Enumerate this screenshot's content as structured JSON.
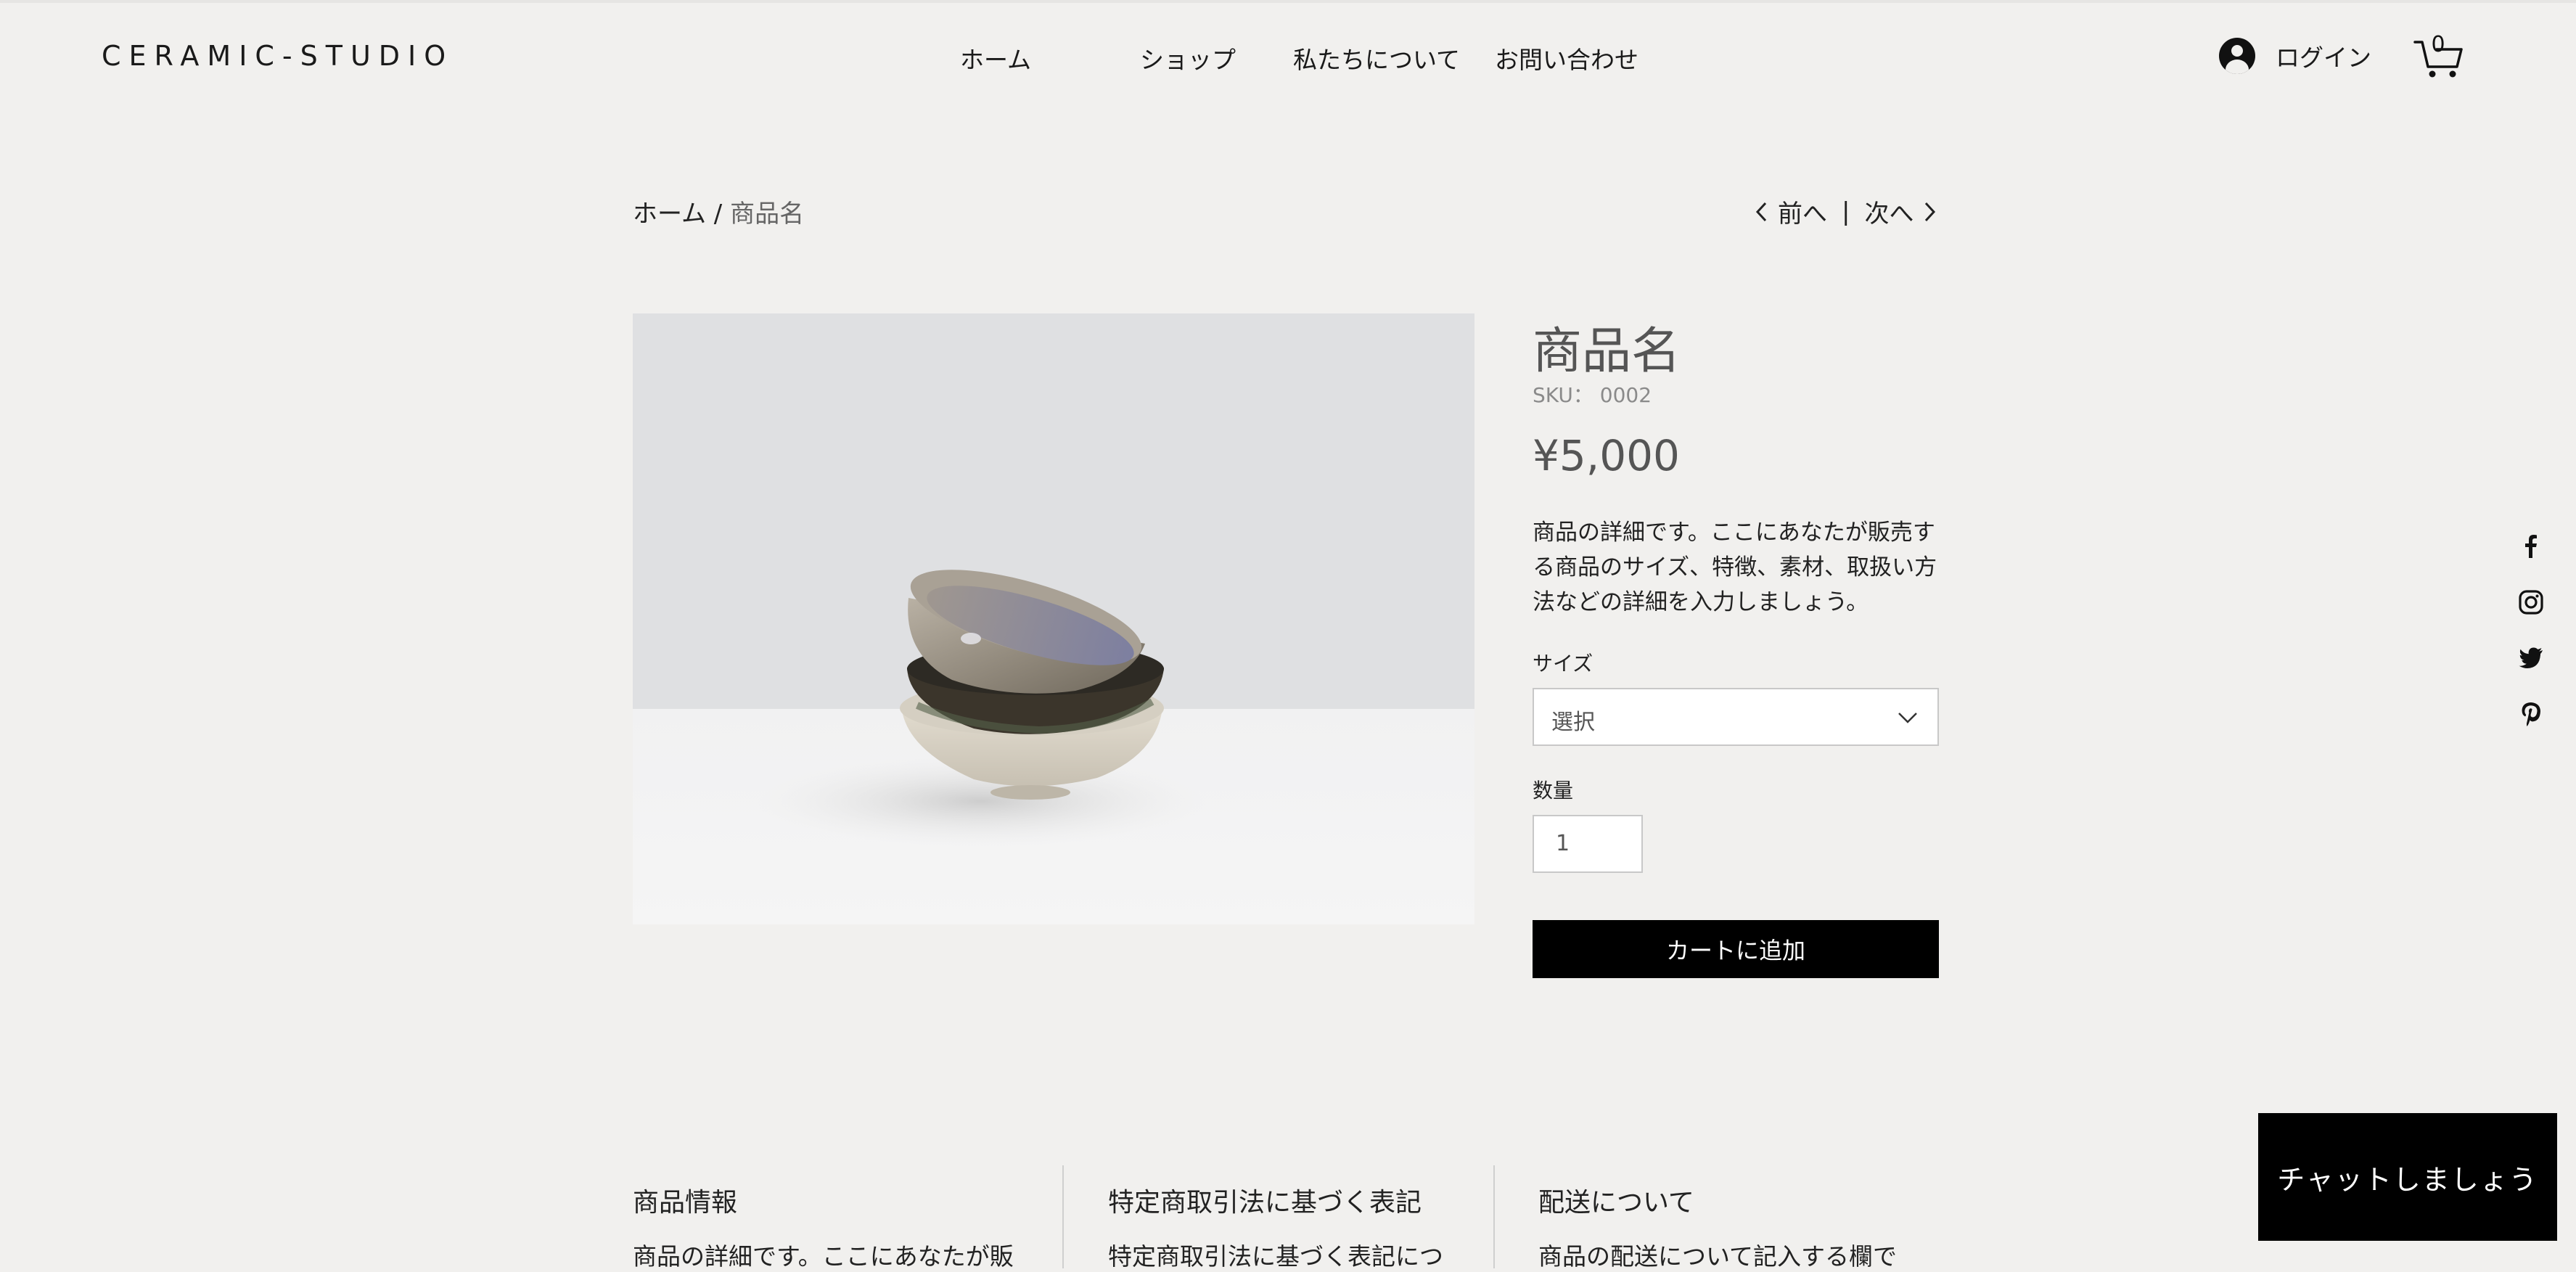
{
  "header": {
    "logo": "CERAMIC-STUDIO",
    "nav": [
      "ホーム",
      "ショップ",
      "私たちについて",
      "お問い合わせ"
    ],
    "login_label": "ログイン",
    "cart_count": "0"
  },
  "breadcrumb": {
    "home": "ホーム",
    "separator": "/",
    "current": "商品名"
  },
  "pager": {
    "prev": "前へ",
    "divider": "|",
    "next": "次へ"
  },
  "product": {
    "title": "商品名",
    "sku": "SKU： 0002",
    "price": "¥5,000",
    "description": "商品の詳細です。ここにあなたが販売する商品のサイズ、特徴、素材、取扱い方法などの詳細を入力しましょう。",
    "size_label": "サイズ",
    "size_value": "選択",
    "quantity_label": "数量",
    "quantity_value": "1",
    "add_to_cart": "カートに追加"
  },
  "social": [
    "facebook-icon",
    "instagram-icon",
    "twitter-icon",
    "pinterest-icon"
  ],
  "sections": [
    {
      "title": "商品情報",
      "body": "商品の詳細です。ここにあなたが販"
    },
    {
      "title": "特定商取引法に基づく表記",
      "body": "特定商取引法に基づく表記につ"
    },
    {
      "title": "配送について",
      "body": "商品の配送について記入する欄で"
    }
  ],
  "chat": {
    "label": "チャットしましょう"
  },
  "colors": {
    "background": "#f1f0ee",
    "button": "#000000",
    "accent_text": "#555555"
  }
}
